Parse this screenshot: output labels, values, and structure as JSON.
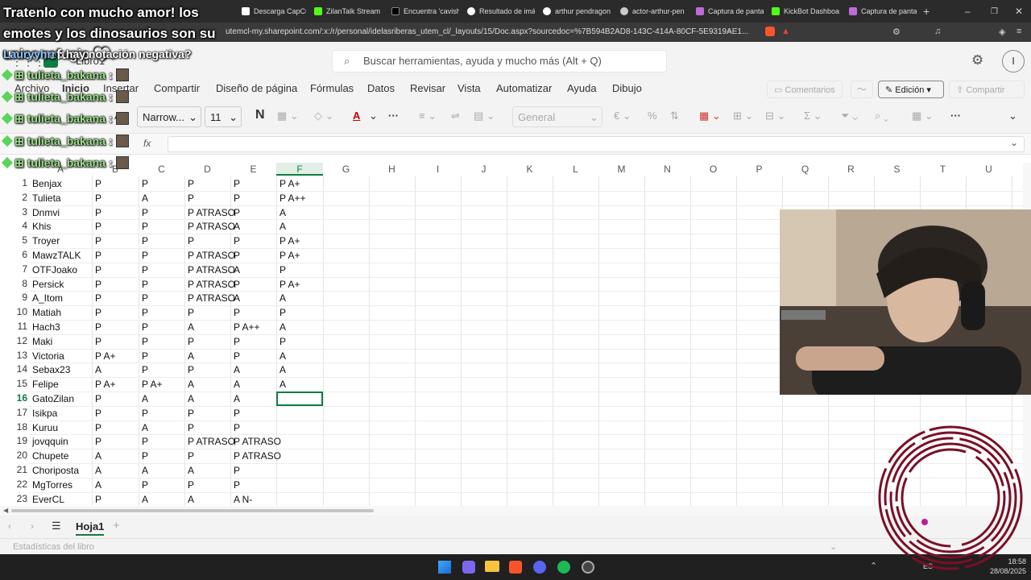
{
  "browser": {
    "tabs": [
      "Descarga CapCut",
      "ZilanTalk Stream",
      "Encuentra 'cavish",
      "Resultado de imá",
      "arthur pendragon",
      "actor-arthur-pen",
      "Captura de panta",
      "KickBot Dashboa",
      "Captura de panta"
    ],
    "tab_partial": "ge",
    "url": "utemcl-my.sharepoint.com/:x:/r/personal/idelasriberas_utem_cl/_layouts/15/Doc.aspx?sourcedoc=%7B594B2AD8-143C-414A-80CF-5E9319AE1..."
  },
  "excel": {
    "doc_title": "Libro1",
    "search_placeholder": "Buscar herramientas, ayuda y mucho más (Alt + Q)",
    "account_initial": "I",
    "menu": [
      "Archivo",
      "Inicio",
      "Insertar",
      "Compartir",
      "Diseño de página",
      "Fórmulas",
      "Datos",
      "Revisar",
      "Vista",
      "Automatizar",
      "Ayuda",
      "Dibujo"
    ],
    "comments_label": "Comentarios",
    "edit_label": "Edición",
    "share_label": "Compartir",
    "font_name": "Narrow...",
    "font_size": "11",
    "bold": "N",
    "number_format": "General",
    "fx": "fx",
    "paste_partial": "Ap",
    "columns": [
      "A",
      "B",
      "C",
      "D",
      "E",
      "F",
      "G",
      "H",
      "I",
      "J",
      "K",
      "L",
      "M",
      "N",
      "O",
      "P",
      "Q",
      "R",
      "S",
      "T",
      "U"
    ],
    "rows": [
      [
        "Benjax",
        "P",
        "P",
        "P",
        "P",
        "P A+"
      ],
      [
        "Tulieta",
        "P",
        "A",
        "P",
        "P",
        "P A++"
      ],
      [
        "Dnmvi",
        "P",
        "P",
        "P ATRASO",
        "P",
        "A"
      ],
      [
        "Khis",
        "P",
        "P",
        "P ATRASO",
        "A",
        "A"
      ],
      [
        "Troyer",
        "P",
        "P",
        "P",
        "P",
        "P A+"
      ],
      [
        "MawzTALK",
        "P",
        "P",
        "P ATRASO",
        "P",
        "P A+"
      ],
      [
        "OTFJoako",
        "P",
        "P",
        "P ATRASO",
        "A",
        "P"
      ],
      [
        "Persick",
        "P",
        "P",
        "P ATRASO",
        "P",
        "P A+"
      ],
      [
        "A_Itom",
        "P",
        "P",
        "P ATRASO",
        "A",
        "A"
      ],
      [
        "Matiah",
        "P",
        "P",
        "P",
        "P",
        "P"
      ],
      [
        "Hach3",
        "P",
        "P",
        "A",
        "P A++",
        "A"
      ],
      [
        "Maki",
        "P",
        "P",
        "P",
        "P",
        "P"
      ],
      [
        "Victoria",
        "P A+",
        "P",
        "A",
        "P",
        "A"
      ],
      [
        "Sebax23",
        "A",
        "P",
        "P",
        "A",
        "A"
      ],
      [
        "Felipe",
        "P A+",
        "P A+",
        "A",
        "A",
        "A"
      ],
      [
        "GatoZilan",
        "P",
        "A",
        "A",
        "A",
        ""
      ],
      [
        "Isikpa",
        "P",
        "P",
        "P",
        "P",
        ""
      ],
      [
        "Kuruu",
        "P",
        "A",
        "P",
        "P",
        ""
      ],
      [
        "jovqquin",
        "P",
        "P",
        "P ATRASO",
        "P ATRASO",
        ""
      ],
      [
        "Chupete",
        "A",
        "P",
        "P",
        "P ATRASO",
        ""
      ],
      [
        "Choriposta",
        "A",
        "A",
        "A",
        "P",
        ""
      ],
      [
        "MgTorres",
        "A",
        "P",
        "P",
        "P",
        ""
      ],
      [
        "EverCL",
        "P",
        "A",
        "A",
        "A N-",
        ""
      ]
    ],
    "sheet_name": "Hoja1",
    "status_text": "Estadísticas del libro"
  },
  "stream_overlay": {
    "title": "Tratenlo con mucho amor! los emotes y los dinosaurios son su unico refugio 🤍.",
    "question_user": "Lauryy​hrr",
    "question_text": ": hay notación negativa?",
    "chat_user": "tulieta_bakana",
    "chat_count": 5
  },
  "taskbar": {
    "time": "18:58",
    "date": "28/08/2025",
    "lang": "ES"
  }
}
